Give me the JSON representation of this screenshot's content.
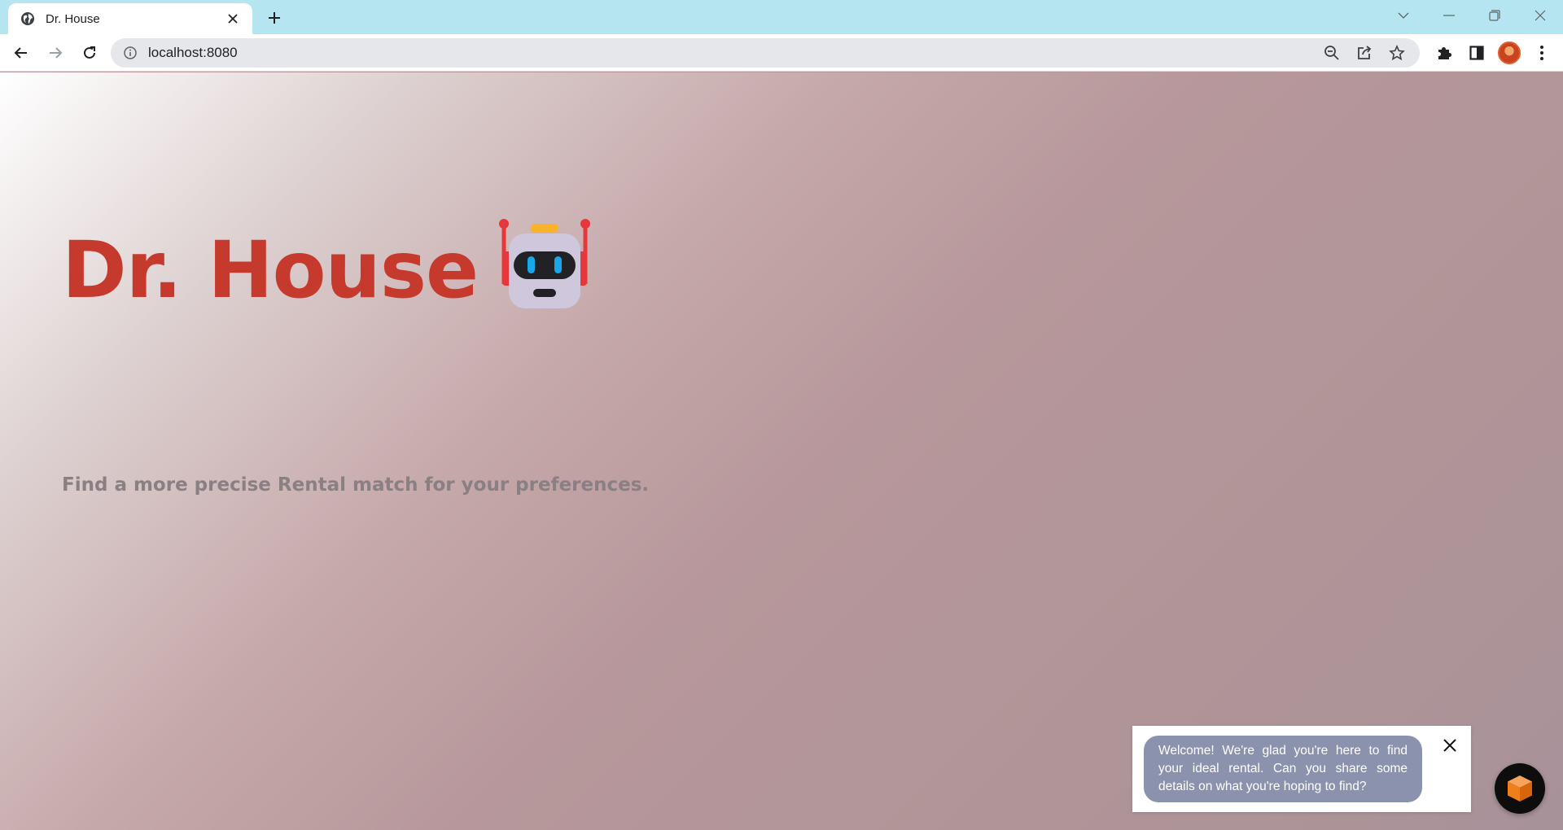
{
  "browser": {
    "tab": {
      "title": "Dr. House",
      "favicon": "globe-icon"
    },
    "address": {
      "url": "localhost:8080"
    },
    "colors": {
      "tabbar": "#b5e5f1",
      "omnibox": "#e6e7ea"
    }
  },
  "page": {
    "title": "Dr. House",
    "title_icon": "robot-icon",
    "tagline": "Find a more precise Rental match for your preferences.",
    "colors": {
      "title": "#c63a2e",
      "tagline": "#8a7f83"
    }
  },
  "chat": {
    "message": "Welcome! We're glad you're here to find your ideal rental. Can you share some details on what you're hoping to find?",
    "launcher_icon": "orange-cube-icon",
    "colors": {
      "bubble": "#8b92ae",
      "launcher": "#0d0d0d",
      "cube": "#f07f1a"
    }
  }
}
